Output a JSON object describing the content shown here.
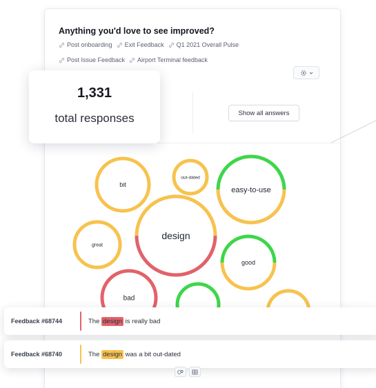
{
  "question": {
    "title": "Anything you'd love to see improved?",
    "tags_row1": [
      "Post onboarding",
      "Exit Feedback",
      "Q1 2021 Overall Pulse"
    ],
    "tags_row2": [
      "Post Issue Feedback",
      "Airport Terminal feedback"
    ]
  },
  "summary": {
    "total": "1,331",
    "label": "total responses"
  },
  "actions": {
    "show_all": "Show all answers"
  },
  "colors": {
    "positive": "#3ed64a",
    "neutral": "#f7c24e",
    "negative": "#e2626b"
  },
  "bubbles": [
    {
      "label": "bit",
      "sentiment": [
        [
          "neutral",
          1.0
        ]
      ]
    },
    {
      "label": "out-dated",
      "sentiment": [
        [
          "neutral",
          1.0
        ]
      ]
    },
    {
      "label": "easy-to-use",
      "sentiment": [
        [
          "positive",
          0.5
        ],
        [
          "neutral",
          0.5
        ]
      ]
    },
    {
      "label": "design",
      "sentiment": [
        [
          "neutral",
          0.5
        ],
        [
          "negative",
          0.5
        ]
      ]
    },
    {
      "label": "great",
      "sentiment": [
        [
          "neutral",
          1.0
        ]
      ]
    },
    {
      "label": "good",
      "sentiment": [
        [
          "positive",
          0.5
        ],
        [
          "neutral",
          0.5
        ]
      ]
    },
    {
      "label": "bad",
      "sentiment": [
        [
          "negative",
          1.0
        ]
      ]
    },
    {
      "label": "",
      "sentiment": [
        [
          "positive",
          1.0
        ]
      ]
    },
    {
      "label": "",
      "sentiment": [
        [
          "neutral",
          1.0
        ]
      ]
    }
  ],
  "feedback": [
    {
      "id": "Feedback #68744",
      "before": "The ",
      "highlight": "design",
      "after": " is really bad",
      "sentiment": "negative",
      "hl_color": "#e2626b"
    },
    {
      "id": "Feedback #68740",
      "before": "The ",
      "highlight": "design",
      "after": " was a bit out-dated",
      "sentiment": "neutral",
      "hl_color": "#f7c24e"
    }
  ],
  "icons": {
    "tag": "link-icon",
    "settings": "gear-icon",
    "chevron": "chevron-down-icon",
    "bubble_view": "bubble-view-icon",
    "table_view": "table-view-icon"
  }
}
